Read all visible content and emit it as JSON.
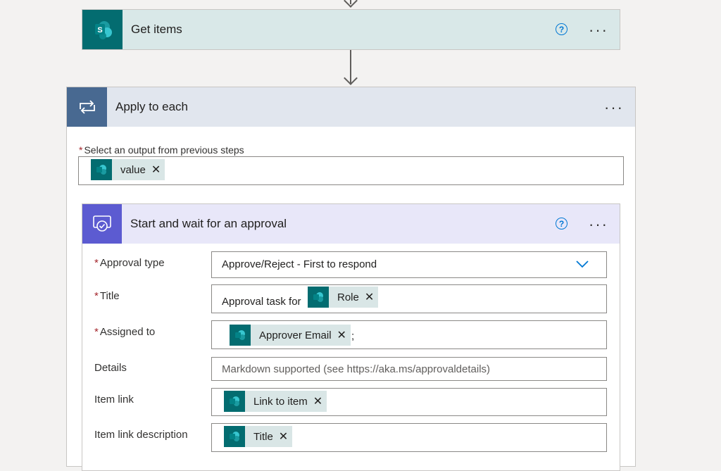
{
  "get_items": {
    "title": "Get items",
    "icon": "sharepoint-icon",
    "icon_letter": "S"
  },
  "apply_to_each": {
    "title": "Apply to each",
    "icon": "loop-icon",
    "output_label": "Select an output from previous steps",
    "output_token": "value"
  },
  "approval": {
    "title": "Start and wait for an approval",
    "icon": "approval-icon",
    "fields": {
      "approval_type": {
        "label": "Approval type",
        "value": "Approve/Reject - First to respond"
      },
      "title": {
        "label": "Title",
        "prefix": "Approval task for",
        "token": "Role"
      },
      "assigned_to": {
        "label": "Assigned to",
        "token": "Approver Email",
        "suffix": ";"
      },
      "details": {
        "label": "Details",
        "placeholder": "Markdown supported (see https://aka.ms/approvaldetails)"
      },
      "item_link": {
        "label": "Item link",
        "token": "Link to item"
      },
      "item_link_description": {
        "label": "Item link description",
        "token": "Title"
      }
    }
  },
  "common": {
    "required_mark": "*",
    "help_glyph": "?",
    "more_glyph": "···",
    "remove_glyph": "✕"
  },
  "colors": {
    "sharepoint_teal": "#036c70",
    "get_items_header": "#d9e8e8",
    "apply_header": "#e1e6ee",
    "apply_icon_bg": "#486991",
    "approval_header": "#e8e7f9",
    "approval_icon_bg": "#5c5bd1",
    "token_bg": "#d9e6e6",
    "required_red": "#a4262c",
    "link_blue": "#0078d4"
  }
}
